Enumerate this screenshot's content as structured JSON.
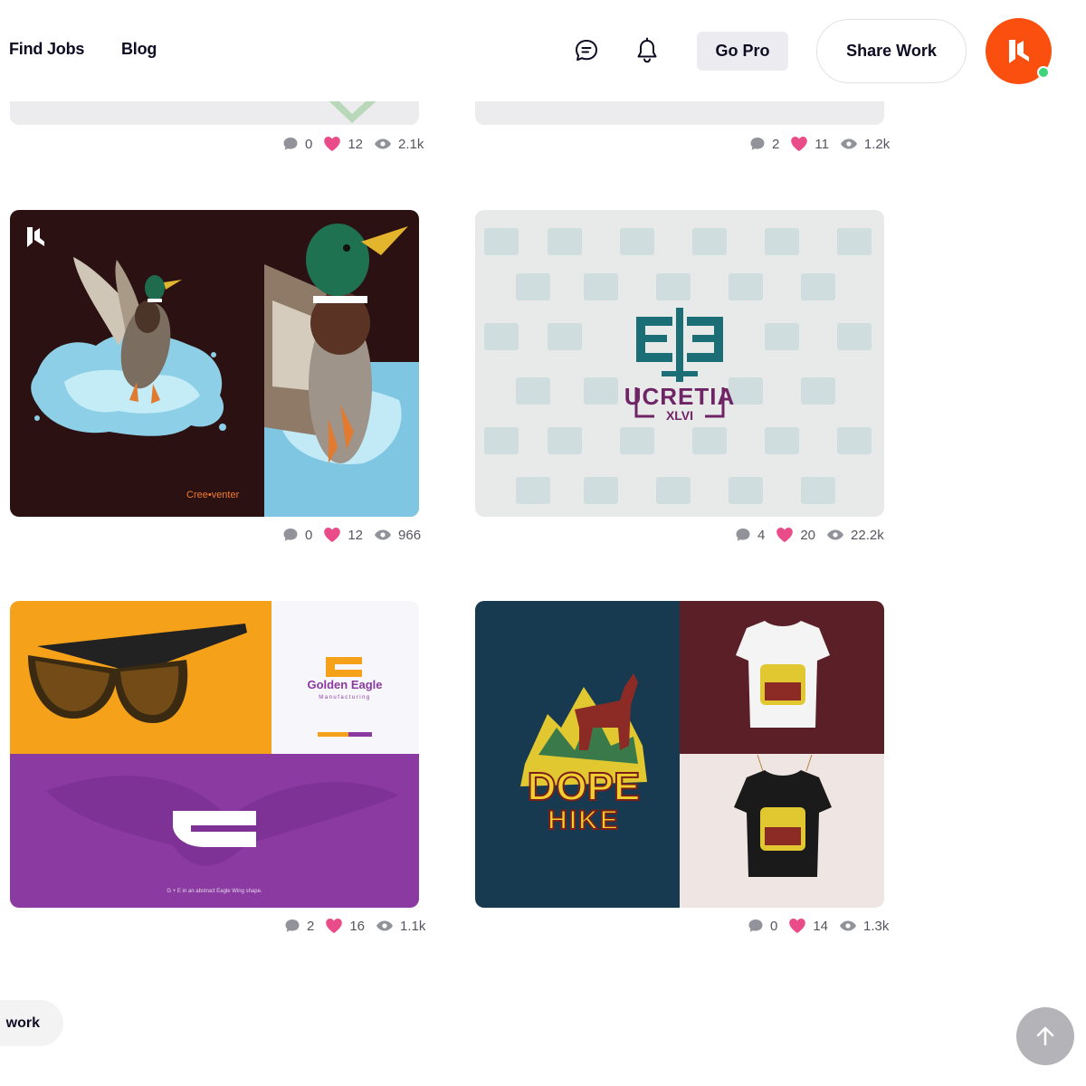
{
  "header": {
    "nav_links": [
      "Find Jobs",
      "Blog"
    ],
    "go_pro_label": "Go Pro",
    "share_work_label": "Share Work",
    "icons": [
      "messages-icon",
      "bell-icon"
    ],
    "avatar_icon": "user-avatar",
    "online_status_color": "#3ed47b"
  },
  "accent_colors": {
    "avatar": "#fa4f0f",
    "like_heart": "#ea4c89"
  },
  "shots": [
    {
      "comments": "0",
      "likes": "12",
      "views": "2.1k"
    },
    {
      "comments": "2",
      "likes": "11",
      "views": "1.2k"
    },
    {
      "comments": "0",
      "likes": "12",
      "views": "966",
      "thumb_text": "Cree•venter"
    },
    {
      "comments": "4",
      "likes": "20",
      "views": "22.2k",
      "thumb_text": "UCRETIA",
      "thumb_subtext": "XLVI"
    },
    {
      "comments": "2",
      "likes": "16",
      "views": "1.1k",
      "thumb_text": "Golden Eagle",
      "thumb_subtext": "Manufacturing",
      "thumb_caption": "G + E in an abstract Eagle Wing shape."
    },
    {
      "comments": "0",
      "likes": "14",
      "views": "1.3k",
      "thumb_text": "DOPE",
      "thumb_subtext": "HIKE"
    }
  ],
  "footer": {
    "work_label": "work",
    "scroll_top_icon": "arrow-up-icon"
  }
}
